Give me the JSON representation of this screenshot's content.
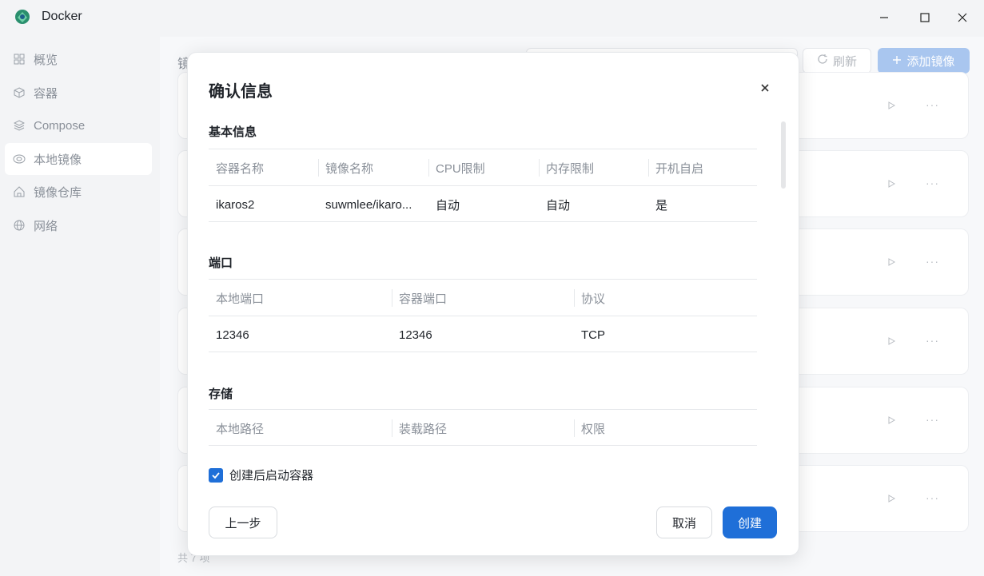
{
  "app": {
    "title": "Docker"
  },
  "sidebar": {
    "items": [
      {
        "label": "概览",
        "icon": "grid-icon"
      },
      {
        "label": "容器",
        "icon": "cube-icon"
      },
      {
        "label": "Compose",
        "icon": "layers-icon"
      },
      {
        "label": "本地镜像",
        "icon": "disk-icon"
      },
      {
        "label": "镜像仓库",
        "icon": "home-icon"
      },
      {
        "label": "网络",
        "icon": "globe-icon"
      }
    ]
  },
  "main": {
    "title": "镜",
    "refresh_label": "刷新",
    "add_label": "添加镜像",
    "footer": "共 7 项"
  },
  "dialog": {
    "title": "确认信息",
    "basic": {
      "title": "基本信息",
      "headers": [
        "容器名称",
        "镜像名称",
        "CPU限制",
        "内存限制",
        "开机自启"
      ],
      "row": [
        "ikaros2",
        "suwmlee/ikaro...",
        "自动",
        "自动",
        "是"
      ]
    },
    "ports": {
      "title": "端口",
      "headers": [
        "本地端口",
        "容器端口",
        "协议"
      ],
      "row": [
        "12346",
        "12346",
        "TCP"
      ]
    },
    "storage": {
      "title": "存储",
      "headers": [
        "本地路径",
        "装载路径",
        "权限"
      ]
    },
    "start_after_create": {
      "label": "创建后启动容器",
      "checked": true
    },
    "buttons": {
      "prev": "上一步",
      "cancel": "取消",
      "create": "创建"
    }
  },
  "colors": {
    "primary": "#1f6fd8",
    "primary_disabled": "#a9c6ef"
  }
}
